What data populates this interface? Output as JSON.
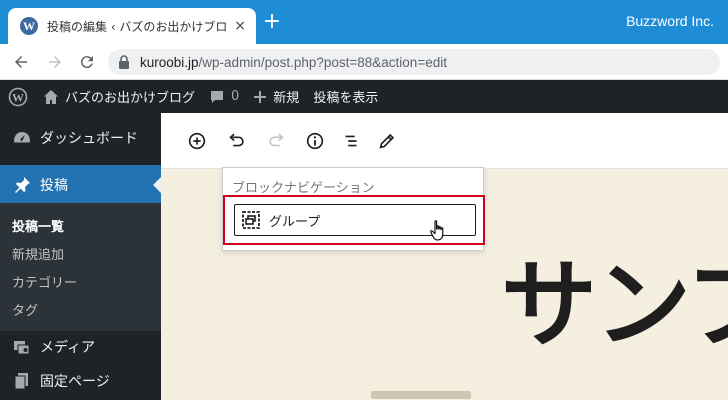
{
  "browser": {
    "tab_title": "投稿の編集 ‹ バズのお出かけブログ — WordPress",
    "tab_close": "×",
    "new_tab": "+",
    "window_title": "Buzzword Inc.",
    "url_host": "kuroobi.jp",
    "url_path": "/wp-admin/post.php?post=88&action=edit"
  },
  "adminbar": {
    "site_name": "バズのお出かけブログ",
    "comments_count": "0",
    "new_label": "新規",
    "view_post_label": "投稿を表示"
  },
  "sidebar": {
    "dashboard": "ダッシュボード",
    "posts": "投稿",
    "submenu": [
      "投稿一覧",
      "新規追加",
      "カテゴリー",
      "タグ"
    ],
    "media": "メディア",
    "pages": "固定ページ"
  },
  "editor": {
    "heading_text": "サンプ"
  },
  "popover": {
    "title": "ブロックナビゲーション",
    "block_label": "グループ"
  },
  "colors": {
    "chrome_blue": "#1f8dd6",
    "wp_dark": "#1d2327",
    "wp_active": "#2271b1",
    "highlight_red": "#d0021b",
    "canvas_bg": "#f5efe0"
  }
}
